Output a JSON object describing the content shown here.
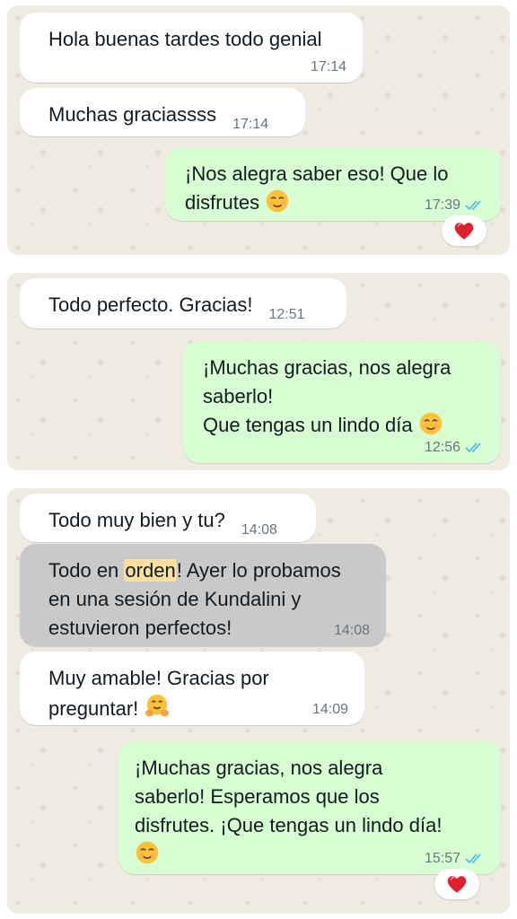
{
  "panel1": {
    "messages": [
      {
        "text": "Hola buenas tardes todo genial",
        "time": "17:14"
      },
      {
        "text": "Muchas graciassss",
        "time": "17:14"
      },
      {
        "line1": "¡Nos alegra saber eso! Que lo",
        "line2": "disfrutes",
        "emoji": "smiling-face",
        "time": "17:39",
        "reaction": "heart"
      }
    ]
  },
  "panel2": {
    "messages": [
      {
        "text": "Todo perfecto. Gracias!",
        "time": "12:51"
      },
      {
        "line1": "¡Muchas gracias, nos alegra",
        "line2": "saberlo!",
        "line3": "Que tengas un lindo día",
        "emoji": "smiling-face",
        "time": "12:56"
      }
    ]
  },
  "panel3": {
    "messages": [
      {
        "text": "Todo muy bien y tu?",
        "time": "14:08"
      },
      {
        "line1_pre": "Todo en ",
        "line1_hl": "orden",
        "line1_post": "! Ayer lo probamos",
        "line2": "en una sesión de Kundalini y",
        "line3": "estuvieron perfectos!",
        "time": "14:08"
      },
      {
        "line1": "Muy amable! Gracias por",
        "line2": "preguntar!",
        "emoji": "hugging-face",
        "time": "14:09"
      },
      {
        "line1": "¡Muchas gracias, nos alegra",
        "line2": "saberlo! Esperamos que los",
        "line3": "disfrutes. ¡Que tengas un lindo día!",
        "emoji": "smiling-face",
        "time": "15:57",
        "reaction": "heart"
      }
    ]
  },
  "colors": {
    "wallpaper": "#efeae2",
    "incoming": "#ffffff",
    "outgoing": "#d9fdd3",
    "selected": "#c9c9c9",
    "read_ticks": "#53bdeb",
    "highlight": "#fadf9f",
    "heart": "#e0202f"
  }
}
